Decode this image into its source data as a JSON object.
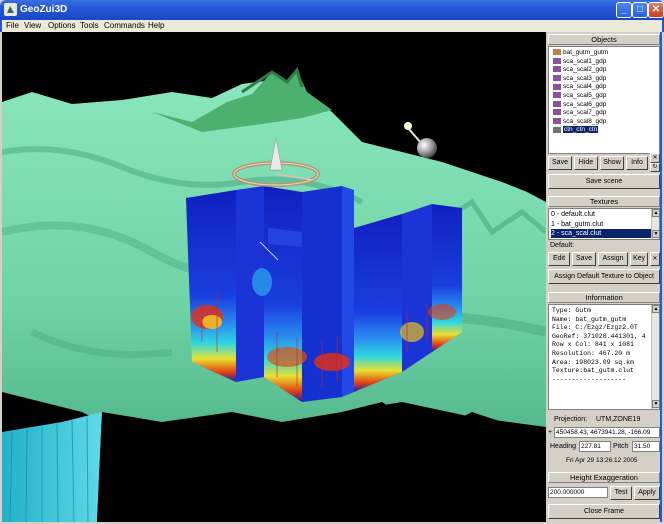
{
  "window": {
    "title": "GeoZui3D",
    "controls": [
      "_",
      "□",
      "✕"
    ]
  },
  "menu": [
    "File",
    "View",
    "Options",
    "Tools",
    "Commands",
    "Help"
  ],
  "objects": {
    "header": "Objects",
    "items": [
      {
        "label": "bat_gutm_gutm",
        "color": "#c08040"
      },
      {
        "label": "sca_scal1_gdp",
        "color": "#9050a0"
      },
      {
        "label": "sca_scal2_gdp",
        "color": "#9050a0"
      },
      {
        "label": "sca_scal3_gdp",
        "color": "#9050a0"
      },
      {
        "label": "sca_scal4_gdp",
        "color": "#9050a0"
      },
      {
        "label": "sca_scal5_gdp",
        "color": "#9050a0"
      },
      {
        "label": "sca_scal6_gdp",
        "color": "#9050a0"
      },
      {
        "label": "sca_scal7_gdp",
        "color": "#9050a0"
      },
      {
        "label": "sca_scal8_gdp",
        "color": "#9050a0"
      },
      {
        "label": "ctn_ctn_ctn",
        "color": "#707070",
        "selected": true
      }
    ],
    "buttons": {
      "save": "Save",
      "hide": "Hide",
      "show": "Show",
      "info": "Info",
      "x": "✕"
    },
    "save_scene": "Save scene"
  },
  "textures": {
    "header": "Textures",
    "items": [
      {
        "label": "0 - default.clut"
      },
      {
        "label": "1 - bat_gutm.clut"
      },
      {
        "label": "2 - sca_scal.clut",
        "selected": true
      }
    ],
    "default_label": "Default:",
    "buttons": {
      "edit": "Edit",
      "save": "Save",
      "assign": "Assign",
      "key": "Key",
      "x": "✕"
    },
    "assign_default": "Assign Default Texture to Object"
  },
  "information": {
    "header": "Information",
    "lines": [
      "Type:   Gutm",
      "Name:   bat_gutm_gutm",
      "File:   C:/Ezgz/Ezgz2.0T",
      "GeoRef: 371028.441301, 4",
      "Row x Col:  841 x 1081",
      "Resolution: 467.20 m",
      "Area:   198023.09 sq.km",
      "Texture:bat_gutm.clut",
      "-------------------"
    ]
  },
  "projection": {
    "label": "Projection:",
    "value": "UTM,ZONE19",
    "coords": "450458.43, 4673941.28, -166.09",
    "heading_label": "Heading",
    "heading": "227.81",
    "pitch_label": "Pitch",
    "pitch": "31.50",
    "timestamp": "Fri Apr 29 13:26:12 2005"
  },
  "height": {
    "header": "Height Exaggeration",
    "value": "200.000000",
    "test": "Test",
    "apply": "Apply"
  },
  "close_frame": "Close Frame",
  "colors": {
    "terrain": "#7fe0b4",
    "terrain_dark": "#3e9f7a",
    "slice_blue": "#1428d0",
    "selection": "#0a246a",
    "titlebar": "#2457d6"
  }
}
